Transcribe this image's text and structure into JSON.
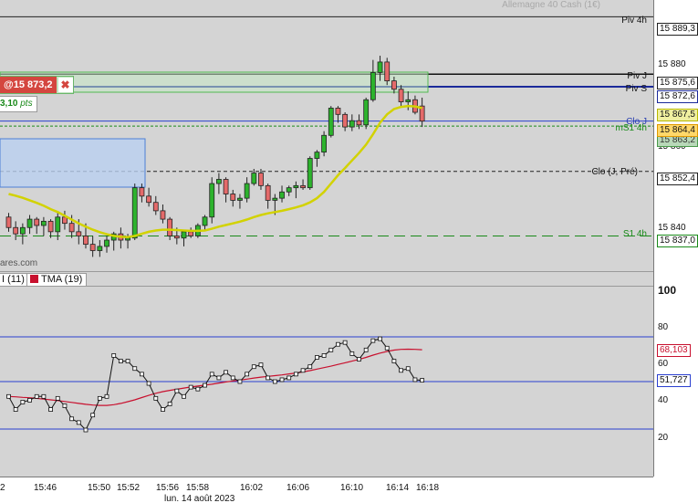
{
  "window": {
    "title": "Allemagne 40 Cash (1€)"
  },
  "order": {
    "label": "@15 873,2",
    "close_icon": "✖",
    "pnl_label": "3,10",
    "pnl_unit": "pts"
  },
  "levels": {
    "piv4h": {
      "label": "Piv 4h",
      "price": "15 889,3"
    },
    "pivj": {
      "label": "Piv J",
      "price": "15 875,6"
    },
    "pivs": {
      "label": "Piv S",
      "price": "15 872,6"
    },
    "cloj": {
      "label": "Clo J",
      "price": "15 864,4"
    },
    "ms14h": {
      "label": "mS1 4h",
      "price": "15 863,2"
    },
    "clojpre": {
      "label": "Clo (J, Pré)",
      "price": "15 852,4"
    },
    "s14h": {
      "label": "S1 4h",
      "price": "15 837,0"
    },
    "current": {
      "price": "15 867,5"
    }
  },
  "price_axis": {
    "ticks": [
      "15 880",
      "15 860",
      "15 840"
    ]
  },
  "osc_axis": {
    "ticks": [
      "100",
      "80",
      "60",
      "40",
      "20"
    ],
    "value_main": "51,727",
    "value_tma": "68,103"
  },
  "legend": {
    "item1": "I (11)",
    "item2": "TMA (19)"
  },
  "watermark": "ares.com",
  "x_axis": {
    "ticks": [
      "2",
      "15:46",
      "15:50",
      "15:52",
      "15:56",
      "15:58",
      "16:02",
      "16:06",
      "16:10",
      "16:14",
      "16:18"
    ],
    "date": "lun. 14 août 2023"
  },
  "colors": {
    "bull": "#2db32d",
    "bear": "#e46a6a",
    "ma": "#c8c800",
    "tma": "#c8102e",
    "osc": "#111111"
  },
  "chart_data": {
    "type": "candlestick",
    "title": "",
    "candles": [
      {
        "o": 15841.5,
        "h": 15842.5,
        "l": 15838,
        "c": 15839
      },
      {
        "o": 15839,
        "h": 15840.5,
        "l": 15836,
        "c": 15837.5
      },
      {
        "o": 15837.5,
        "h": 15840,
        "l": 15835,
        "c": 15839
      },
      {
        "o": 15839,
        "h": 15842,
        "l": 15837.5,
        "c": 15841
      },
      {
        "o": 15841,
        "h": 15841.5,
        "l": 15837.5,
        "c": 15839.5
      },
      {
        "o": 15839.5,
        "h": 15841.5,
        "l": 15837,
        "c": 15840.5
      },
      {
        "o": 15840.5,
        "h": 15841,
        "l": 15836.5,
        "c": 15838
      },
      {
        "o": 15838,
        "h": 15842.5,
        "l": 15836,
        "c": 15841.5
      },
      {
        "o": 15841.5,
        "h": 15843,
        "l": 15838.5,
        "c": 15840
      },
      {
        "o": 15840,
        "h": 15842,
        "l": 15836.5,
        "c": 15838
      },
      {
        "o": 15838,
        "h": 15841,
        "l": 15835,
        "c": 15837
      },
      {
        "o": 15837,
        "h": 15840,
        "l": 15834,
        "c": 15835
      },
      {
        "o": 15835,
        "h": 15837,
        "l": 15832,
        "c": 15833.5
      },
      {
        "o": 15833.5,
        "h": 15836,
        "l": 15832,
        "c": 15834.5
      },
      {
        "o": 15834.5,
        "h": 15837,
        "l": 15833,
        "c": 15836
      },
      {
        "o": 15836,
        "h": 15838,
        "l": 15833.5,
        "c": 15837.5
      },
      {
        "o": 15837.5,
        "h": 15839,
        "l": 15834,
        "c": 15836
      },
      {
        "o": 15836,
        "h": 15837.5,
        "l": 15834,
        "c": 15836.5
      },
      {
        "o": 15836.5,
        "h": 15849.5,
        "l": 15836,
        "c": 15848.5
      },
      {
        "o": 15848.5,
        "h": 15849.5,
        "l": 15845,
        "c": 15846.5
      },
      {
        "o": 15846.5,
        "h": 15848.5,
        "l": 15844,
        "c": 15845
      },
      {
        "o": 15845,
        "h": 15846.5,
        "l": 15842,
        "c": 15843
      },
      {
        "o": 15843,
        "h": 15844.5,
        "l": 15840,
        "c": 15841
      },
      {
        "o": 15841,
        "h": 15841.5,
        "l": 15836,
        "c": 15837
      },
      {
        "o": 15837,
        "h": 15839,
        "l": 15835,
        "c": 15836.5
      },
      {
        "o": 15836.5,
        "h": 15838,
        "l": 15834.5,
        "c": 15838
      },
      {
        "o": 15838,
        "h": 15839,
        "l": 15836.5,
        "c": 15837
      },
      {
        "o": 15837,
        "h": 15840,
        "l": 15836.5,
        "c": 15839.5
      },
      {
        "o": 15839.5,
        "h": 15842,
        "l": 15838.5,
        "c": 15841.5
      },
      {
        "o": 15841.5,
        "h": 15851,
        "l": 15840,
        "c": 15849.5
      },
      {
        "o": 15849.5,
        "h": 15852,
        "l": 15847,
        "c": 15850.5
      },
      {
        "o": 15850.5,
        "h": 15851,
        "l": 15845,
        "c": 15847
      },
      {
        "o": 15847,
        "h": 15848,
        "l": 15844,
        "c": 15845.5
      },
      {
        "o": 15845.5,
        "h": 15847,
        "l": 15843.5,
        "c": 15846
      },
      {
        "o": 15846,
        "h": 15851,
        "l": 15845,
        "c": 15849.5
      },
      {
        "o": 15849.5,
        "h": 15853,
        "l": 15849,
        "c": 15852
      },
      {
        "o": 15852,
        "h": 15853,
        "l": 15848,
        "c": 15849
      },
      {
        "o": 15849,
        "h": 15849.5,
        "l": 15843.5,
        "c": 15845.5
      },
      {
        "o": 15845.5,
        "h": 15847,
        "l": 15842,
        "c": 15846
      },
      {
        "o": 15846,
        "h": 15849,
        "l": 15845,
        "c": 15847.5
      },
      {
        "o": 15847.5,
        "h": 15849,
        "l": 15846.5,
        "c": 15848.5
      },
      {
        "o": 15848.5,
        "h": 15850,
        "l": 15846,
        "c": 15849
      },
      {
        "o": 15849,
        "h": 15850.5,
        "l": 15848,
        "c": 15848.5
      },
      {
        "o": 15848.5,
        "h": 15856,
        "l": 15848,
        "c": 15855.5
      },
      {
        "o": 15855.5,
        "h": 15857.5,
        "l": 15853.5,
        "c": 15857
      },
      {
        "o": 15857,
        "h": 15862,
        "l": 15856,
        "c": 15861
      },
      {
        "o": 15861,
        "h": 15868,
        "l": 15860.5,
        "c": 15867.5
      },
      {
        "o": 15867.5,
        "h": 15868,
        "l": 15864,
        "c": 15866
      },
      {
        "o": 15866,
        "h": 15866.5,
        "l": 15862,
        "c": 15863
      },
      {
        "o": 15863,
        "h": 15866,
        "l": 15862,
        "c": 15864.5
      },
      {
        "o": 15864.5,
        "h": 15866,
        "l": 15862.5,
        "c": 15863.5
      },
      {
        "o": 15863.5,
        "h": 15870,
        "l": 15862.5,
        "c": 15869.5
      },
      {
        "o": 15869.5,
        "h": 15879,
        "l": 15869,
        "c": 15876
      },
      {
        "o": 15876,
        "h": 15880,
        "l": 15874,
        "c": 15878.5
      },
      {
        "o": 15878.5,
        "h": 15879.5,
        "l": 15873,
        "c": 15874
      },
      {
        "o": 15874,
        "h": 15875,
        "l": 15871,
        "c": 15872
      },
      {
        "o": 15872,
        "h": 15873,
        "l": 15868,
        "c": 15869
      },
      {
        "o": 15869,
        "h": 15871.5,
        "l": 15867,
        "c": 15869.5
      },
      {
        "o": 15869.5,
        "h": 15870.5,
        "l": 15866,
        "c": 15866.5
      },
      {
        "o": 15868,
        "h": 15870,
        "l": 15863,
        "c": 15864.4
      }
    ],
    "ma": [
      15847,
      15846.6,
      15846.1,
      15845.5,
      15844.9,
      15844.2,
      15843.4,
      15842.7,
      15841.8,
      15840.9,
      15840,
      15839.2,
      15838.5,
      15837.9,
      15837.4,
      15837,
      15836.8,
      15836.7,
      15837,
      15837.5,
      15838,
      15838.3,
      15838.5,
      15838.5,
      15838.4,
      15838.3,
      15838.2,
      15838.2,
      15838.3,
      15838.7,
      15839.2,
      15839.6,
      15840,
      15840.4,
      15840.9,
      15841.5,
      15842,
      15842.4,
      15842.7,
      15843,
      15843.4,
      15843.8,
      15844.3,
      15845,
      15846,
      15847.5,
      15849.5,
      15851.5,
      15853.2,
      15855,
      15856.8,
      15858.8,
      15861.3,
      15864,
      15866,
      15867.3,
      15867.8,
      15868,
      15867.9,
      15867.5
    ],
    "oscillator": [
      43,
      36,
      40,
      41,
      43,
      43,
      36,
      42,
      38,
      31,
      29,
      25,
      33,
      42,
      43,
      65,
      62,
      62,
      58,
      55,
      50,
      42,
      36,
      39,
      46,
      43,
      48,
      47,
      49,
      55,
      53,
      56,
      53,
      51,
      55,
      59,
      60,
      53,
      51,
      52,
      53,
      55,
      57,
      59,
      64,
      65,
      68,
      71,
      72,
      66,
      63,
      68,
      73,
      74,
      69,
      62,
      57,
      58,
      52,
      51.7
    ],
    "tma": [
      43,
      42.8,
      42.5,
      42.3,
      42,
      41.6,
      41.2,
      40.8,
      40.3,
      39.8,
      39.3,
      38.8,
      38.4,
      38.2,
      38.2,
      38.6,
      39.3,
      40.2,
      41.2,
      42.4,
      43.6,
      44.7,
      45.6,
      46.3,
      46.9,
      47.5,
      48.1,
      48.6,
      49.1,
      49.6,
      50.2,
      50.8,
      51.3,
      51.8,
      52.3,
      52.9,
      53.4,
      53.8,
      54.2,
      54.6,
      55.1,
      55.6,
      56.2,
      56.9,
      57.7,
      58.5,
      59.3,
      60.2,
      61.1,
      62,
      62.9,
      64,
      65.2,
      66.3,
      67.2,
      67.9,
      68.3,
      68.4,
      68.3,
      68.1
    ],
    "y_range": [
      15828.6,
      15893.3
    ],
    "osc_range": [
      0,
      102
    ]
  }
}
